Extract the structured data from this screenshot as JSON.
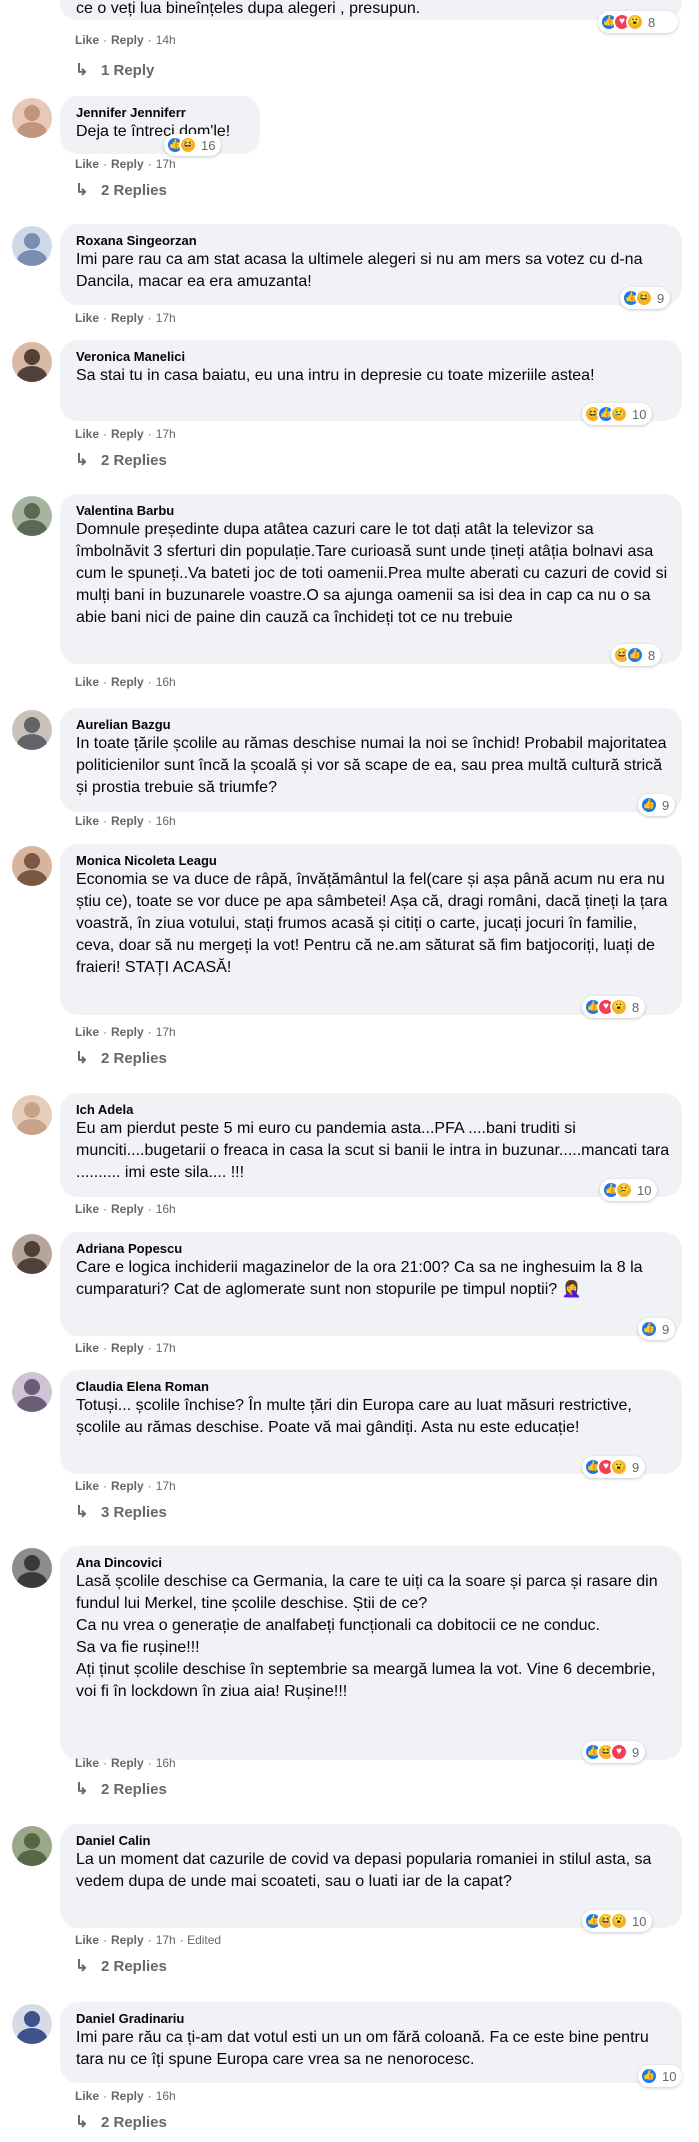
{
  "ui": {
    "like_label": "Like",
    "reply_label": "Reply",
    "sep": "·"
  },
  "top": {
    "text": "ce o veți lua bineînțeles dupa alegeri , presupun.",
    "time": "14h",
    "reactions": [
      "like",
      "love",
      "wow"
    ],
    "count": "8",
    "replies": "1 Reply"
  },
  "comments": [
    {
      "author": "Jennifer Jenniferr",
      "text": "Deja te întreci dom'le!",
      "time": "17h",
      "edited": "",
      "reactions": [
        "like",
        "haha"
      ],
      "count": "16",
      "replies": "2 Replies",
      "avatar": [
        "#e8c9b8",
        "#b98b72"
      ]
    },
    {
      "author": "Roxana Singeorzan",
      "text": "Imi pare rau ca am stat acasa la ultimele alegeri si nu am mers sa votez cu d-na Dancila, macar ea era amuzanta!",
      "time": "17h",
      "edited": "",
      "reactions": [
        "like",
        "haha"
      ],
      "count": "9",
      "replies": "",
      "avatar": [
        "#cfd8e6",
        "#6a7fa8"
      ]
    },
    {
      "author": "Veronica Manelici",
      "text": "Sa stai tu in casa baiatu, eu una intru in depresie cu toate mizeriile astea!",
      "time": "17h",
      "edited": "",
      "reactions": [
        "haha",
        "like",
        "sad"
      ],
      "count": "10",
      "replies": "2 Replies",
      "avatar": [
        "#d9b9a4",
        "#3a2c28"
      ]
    },
    {
      "author": "Valentina Barbu",
      "text": "Domnule președinte dupa atâtea cazuri care le tot dați atât la televizor sa îmbolnăvit 3 sferturi din populație.Tare curioasă sunt unde țineți atâția bolnavi asa cum le spuneți..Va bateti joc de toti oamenii.Prea multe aberati cu cazuri de covid si mulți bani in buzunarele voastre.O sa ajunga oamenii sa isi dea in cap ca nu o sa abie bani nici de paine din cauză ca închideți tot ce nu trebuie",
      "time": "16h",
      "edited": "",
      "reactions": [
        "haha",
        "like"
      ],
      "count": "8",
      "replies": "",
      "avatar": [
        "#a7b5a0",
        "#4d5a46"
      ]
    },
    {
      "author": "Aurelian Bazgu",
      "text": "In toate țările școlile au rămas deschise numai la noi se închid! Probabil majoritatea politicienilor sunt încă la școală și vor să scape de ea, sau prea multă cultură strică și prostia trebuie să triumfe?",
      "time": "16h",
      "edited": "",
      "reactions": [
        "like"
      ],
      "count": "9",
      "replies": "",
      "avatar": [
        "#c9c2bb",
        "#50535a"
      ]
    },
    {
      "author": "Monica Nicoleta Leagu",
      "text": "Economia se va duce de râpă, învățământul la fel(care și așa până acum nu era nu știu ce), toate se vor duce pe apa sâmbetei! Așa că, dragi români, dacă țineți la țara voastră, în ziua votului, stați frumos acasă și citiți o carte, jucați jocuri în familie, ceva, doar să nu mergeți la vot! Pentru că ne.am săturat să fim batjocoriți, luați de fraieri! STAȚI ACASĂ!",
      "time": "17h",
      "edited": "",
      "reactions": [
        "like",
        "love",
        "wow"
      ],
      "count": "8",
      "replies": "2 Replies",
      "avatar": [
        "#d8b49e",
        "#6b4636"
      ]
    },
    {
      "author": "Ich Adela",
      "text": "Eu am pierdut peste 5 mi euro cu pandemia asta...PFA ....bani truditi si munciti....bugetarii o freaca in casa la scut si banii le intra in buzunar.....mancati tara .......... imi este sila.... !!!",
      "time": "16h",
      "edited": "",
      "reactions": [
        "like",
        "sad"
      ],
      "count": "10",
      "replies": "",
      "avatar": [
        "#e6cdb9",
        "#c29a80"
      ]
    },
    {
      "author": "Adriana Popescu",
      "text": "Care e logica inchiderii magazinelor de la ora 21:00? Ca sa ne inghesuim la 8 la cumparaturi? Cat de aglomerate sunt non stopurile pe timpul noptii? 🤦‍♀️",
      "time": "17h",
      "edited": "",
      "reactions": [
        "like"
      ],
      "count": "9",
      "replies": "",
      "avatar": [
        "#b7a49a",
        "#3d2f2b"
      ]
    },
    {
      "author": "Claudia Elena Roman",
      "text": "Totuși... școlile închise? În multe țări din Europa care au luat măsuri restrictive, școlile au rămas deschise. Poate vă mai gândiți. Asta nu este educație!",
      "time": "17h",
      "edited": "",
      "reactions": [
        "like",
        "love",
        "wow"
      ],
      "count": "9",
      "replies": "3 Replies",
      "avatar": [
        "#cfc3d6",
        "#5b4a66"
      ]
    },
    {
      "author": "Ana Dincovici",
      "text": "Lasă școlile deschise ca Germania, la care te uiți ca la soare și parca și rasare din fundul lui Merkel, tine școlile deschise. Știi de ce?\nCa nu vrea o generație de analfabeți funcționali ca dobitocii ce ne conduc.\nSa va fie rușine!!!\nAți ținut școlile deschise în septembrie sa meargă lumea la vot. Vine 6 decembrie, voi fi în lockdown în ziua aia! Rușine!!!",
      "time": "16h",
      "edited": "",
      "reactions": [
        "like",
        "haha",
        "love"
      ],
      "count": "9",
      "replies": "2 Replies",
      "avatar": [
        "#8c8c8c",
        "#2b2b2b"
      ]
    },
    {
      "author": "Daniel Calin",
      "text": "La un moment dat cazurile de covid va depasi popularia romaniei in stilul asta, sa vedem dupa de unde mai scoateti, sau o luati iar de la capat?",
      "time": "17h",
      "edited": "· Edited",
      "reactions": [
        "like",
        "haha",
        "wow"
      ],
      "count": "10",
      "replies": "2 Replies",
      "avatar": [
        "#9aa88a",
        "#4c5a3c"
      ]
    },
    {
      "author": "Daniel Gradinariu",
      "text": "Imi pare rău ca ți-am dat votul esti un un om fără coloană. Fa ce este bine pentru tara nu ce îți spune Europa care vrea sa ne nenorocesc.",
      "time": "16h",
      "edited": "",
      "reactions": [
        "like"
      ],
      "count": "10",
      "replies": "2 Replies",
      "avatar": [
        "#d6dbe6",
        "#233a7a"
      ]
    }
  ]
}
